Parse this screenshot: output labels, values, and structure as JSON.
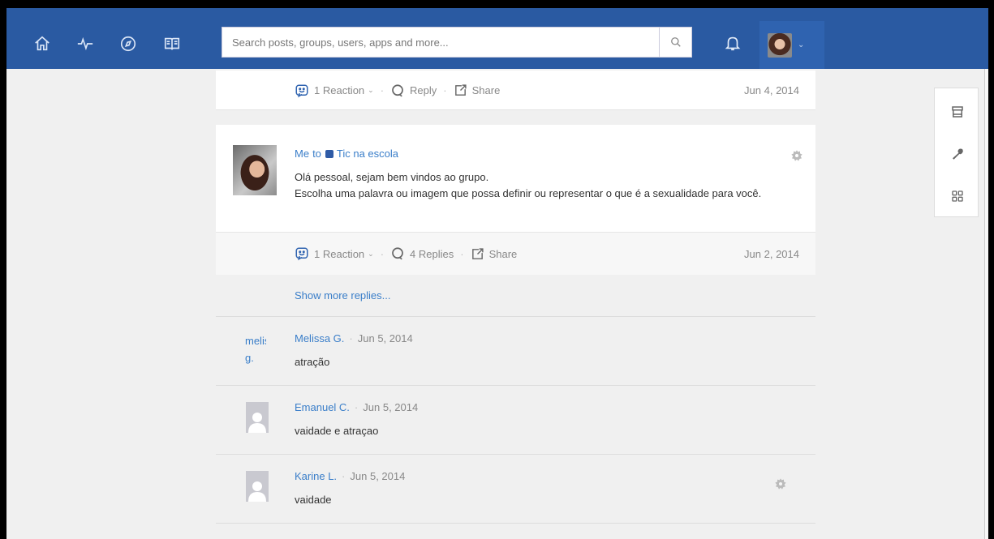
{
  "nav": {
    "icons": [
      "home-icon",
      "activity-icon",
      "explore-icon",
      "book-icon"
    ],
    "search_placeholder": "Search posts, groups, users, apps and more...",
    "search_icon": "search-icon",
    "bell_icon": "bell-icon",
    "colors": {
      "bar": "#2a5aa2",
      "link": "#3a7ec9"
    }
  },
  "right_tools": [
    "store-icon",
    "wrench-icon",
    "grid-icon"
  ],
  "top_card": {
    "reaction": "1 Reaction",
    "reply": "Reply",
    "share": "Share",
    "date": "Jun 4, 2014"
  },
  "post": {
    "author": "Me",
    "to": "to",
    "group": "Tic na escola",
    "line1": "Olá pessoal, sejam bem vindos ao grupo.",
    "line2": "Escolha uma palavra ou imagem que possa definir ou representar o que é a sexualidade para você.",
    "reaction": "1 Reaction",
    "replies": "4 Replies",
    "share": "Share",
    "date": "Jun 2, 2014"
  },
  "show_more": "Show more replies...",
  "replies": [
    {
      "avatar_text": "melissa g.",
      "name": "Melissa G.",
      "date": "Jun 5, 2014",
      "text": "atração"
    },
    {
      "name": "Emanuel C.",
      "date": "Jun 5, 2014",
      "text": "vaidade e atraçao"
    },
    {
      "name": "Karine L.",
      "date": "Jun 5, 2014",
      "text": "vaidade"
    }
  ],
  "sep": "·"
}
